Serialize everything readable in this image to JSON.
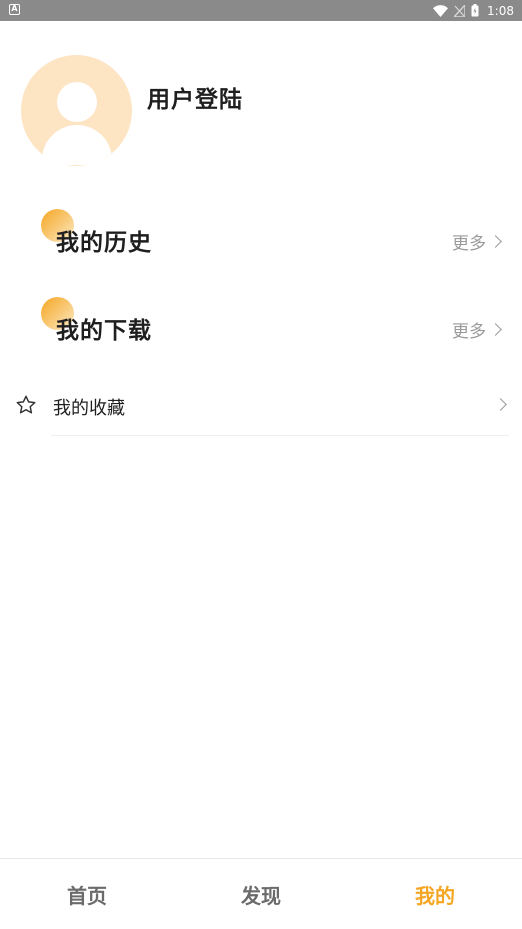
{
  "status_bar": {
    "time": "1:08",
    "icons": [
      "app-notification-icon",
      "wifi-icon",
      "no-signal-icon",
      "battery-icon"
    ]
  },
  "profile": {
    "login_label": "用户登陆",
    "avatar_icon": "default-avatar-icon",
    "avatar_color": "#fde4c3"
  },
  "sections": {
    "history": {
      "title": "我的历史",
      "more": "更多"
    },
    "downloads": {
      "title": "我的下载",
      "more": "更多"
    }
  },
  "favorites": {
    "label": "我的收藏",
    "icon": "star-outline-icon"
  },
  "bottom_nav": {
    "items": [
      {
        "label": "首页",
        "active": false
      },
      {
        "label": "发现",
        "active": false
      },
      {
        "label": "我的",
        "active": true
      }
    ],
    "active_color": "#f5a623",
    "inactive_color": "#6b6b6b"
  }
}
